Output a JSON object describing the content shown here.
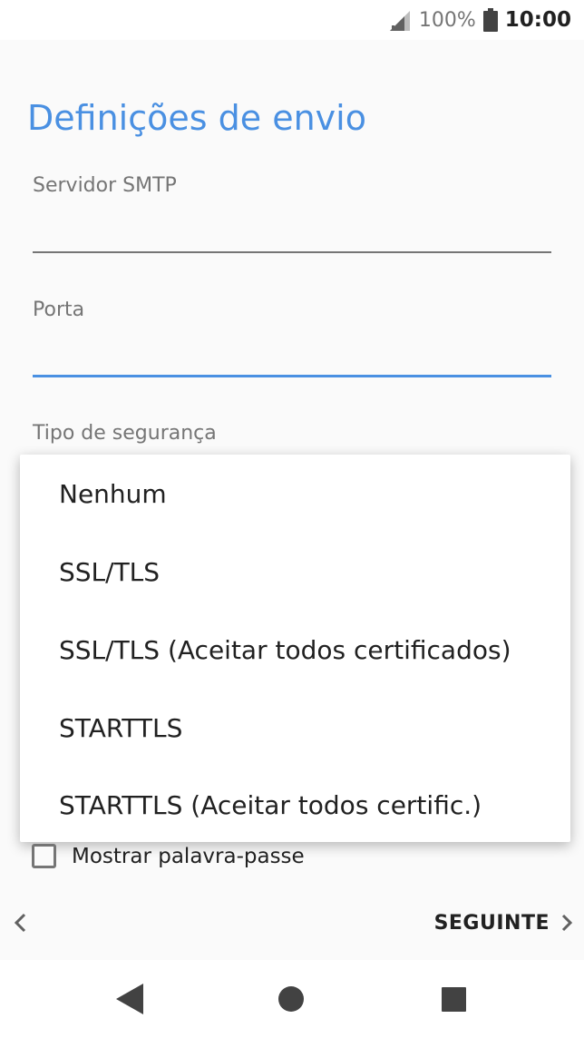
{
  "status_bar": {
    "battery_percent": "100%",
    "time": "10:00",
    "icons": [
      "signal-icon",
      "battery-icon"
    ]
  },
  "page": {
    "title": "Definições de envio"
  },
  "fields": {
    "smtp_label": "Servidor SMTP",
    "smtp_value": "",
    "port_label": "Porta",
    "port_value": "",
    "security_label": "Tipo de segurança"
  },
  "security_dropdown": {
    "options": [
      "Nenhum",
      "SSL/TLS",
      "SSL/TLS (Aceitar todos certificados)",
      "STARTTLS",
      "STARTTLS (Aceitar todos certific.)"
    ]
  },
  "show_password": {
    "label": "Mostrar palavra-passe",
    "checked": false
  },
  "footer": {
    "next_label": "SEGUINTE"
  },
  "colors": {
    "accent": "#4a90e2",
    "background": "#fafafa",
    "text": "#212121",
    "secondary_text": "#757575",
    "line_inactive": "#757575",
    "line_active": "#4a90e2"
  }
}
